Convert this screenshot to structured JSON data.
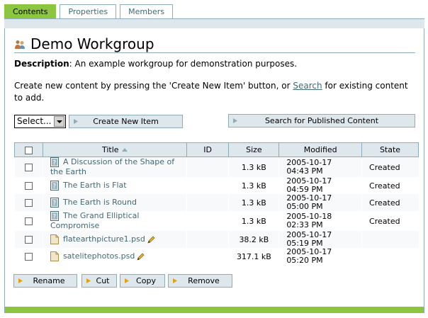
{
  "tabs": [
    {
      "label": "Contents",
      "active": true
    },
    {
      "label": "Properties",
      "active": false
    },
    {
      "label": "Members",
      "active": false
    }
  ],
  "page": {
    "title": "Demo Workgroup",
    "description_label": "Description",
    "description_text": ": An example workgroup for demonstration purposes.",
    "intro_before": "Create new content by pressing the 'Create New Item' button, or ",
    "intro_link": "Search",
    "intro_after": " for existing content to add."
  },
  "controls": {
    "select_value": "Select...",
    "create_label": "Create New Item",
    "search_published_label": "Search for Published Content"
  },
  "table": {
    "headers": {
      "title": "Title",
      "id": "ID",
      "size": "Size",
      "modified": "Modified",
      "state": "State"
    },
    "rows": [
      {
        "title": "A Discussion of the Shape of the Earth",
        "size": "1.3 kB",
        "mod_date": "2005-10-17",
        "mod_time": "04:43 PM",
        "state": "Created",
        "icon": "document-icon",
        "editable": false
      },
      {
        "title": "The Earth is Flat",
        "size": "1.3 kB",
        "mod_date": "2005-10-17",
        "mod_time": "04:59 PM",
        "state": "Created",
        "icon": "document-icon",
        "editable": false
      },
      {
        "title": "The Earth is Round",
        "size": "1.3 kB",
        "mod_date": "2005-10-17",
        "mod_time": "05:00 PM",
        "state": "Created",
        "icon": "document-icon",
        "editable": false
      },
      {
        "title": "The Grand Elliptical Compromise",
        "size": "1.3 kB",
        "mod_date": "2005-10-18",
        "mod_time": "02:33 PM",
        "state": "Created",
        "icon": "document-icon",
        "editable": false
      },
      {
        "title": "flatearthpicture1.psd",
        "size": "38.2 kB",
        "mod_date": "2005-10-17",
        "mod_time": "05:19 PM",
        "state": "",
        "icon": "file-icon",
        "editable": true
      },
      {
        "title": "satelitephotos.psd",
        "size": "317.1 kB",
        "mod_date": "2005-10-17",
        "mod_time": "05:20 PM",
        "state": "",
        "icon": "file-icon",
        "editable": true
      }
    ]
  },
  "actions": {
    "rename": "Rename",
    "cut": "Cut",
    "copy": "Copy",
    "remove": "Remove"
  },
  "colors": {
    "accent": "#8cc63f",
    "border": "#8cacbb",
    "header_bg": "#dee7ec",
    "link": "#436976"
  }
}
